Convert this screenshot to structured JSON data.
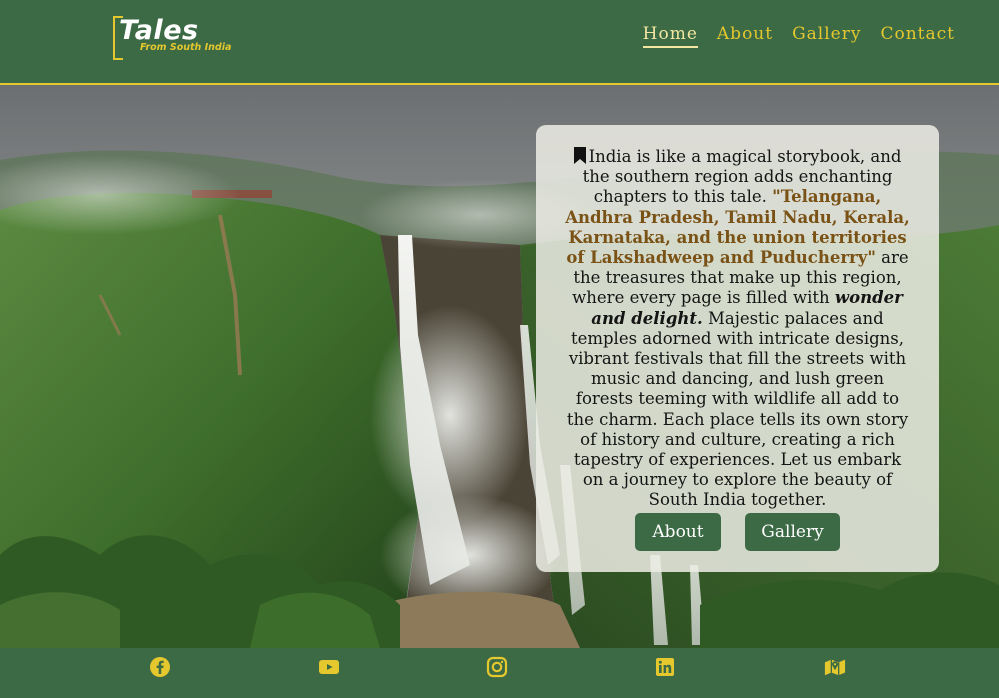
{
  "brand": {
    "title": "Tales",
    "subtitle": "From South India"
  },
  "nav": {
    "items": [
      "Home",
      "About",
      "Gallery",
      "Contact"
    ],
    "active": "Home"
  },
  "card": {
    "intro": "India is like a magical storybook, and the southern region adds enchanting chapters to this tale. ",
    "highlight": "\"Telangana, Andhra Pradesh, Tamil Nadu, Kerala, Karnataka, and the union territories of Lakshadweep and Puducherry\"",
    "middle": " are the treasures that make up this region, where every page is filled with ",
    "emphasis": "wonder and delight.",
    "rest": " Majestic palaces and temples adorned with intricate designs, vibrant festivals that fill the streets with music and dancing, and lush green forests teeming with wildlife all add to the charm. Each place tells its own story of history and culture, creating a rich tapestry of experiences. Let us embark on a journey to explore the beauty of South India together.",
    "buttons": {
      "about": "About",
      "gallery": "Gallery"
    }
  },
  "footer": {
    "icons": [
      "facebook-icon",
      "youtube-icon",
      "instagram-icon",
      "linkedin-icon",
      "map-icon"
    ]
  },
  "colors": {
    "primary": "#3b6a45",
    "accent": "#e5c72e",
    "highlight": "#7a5216"
  }
}
